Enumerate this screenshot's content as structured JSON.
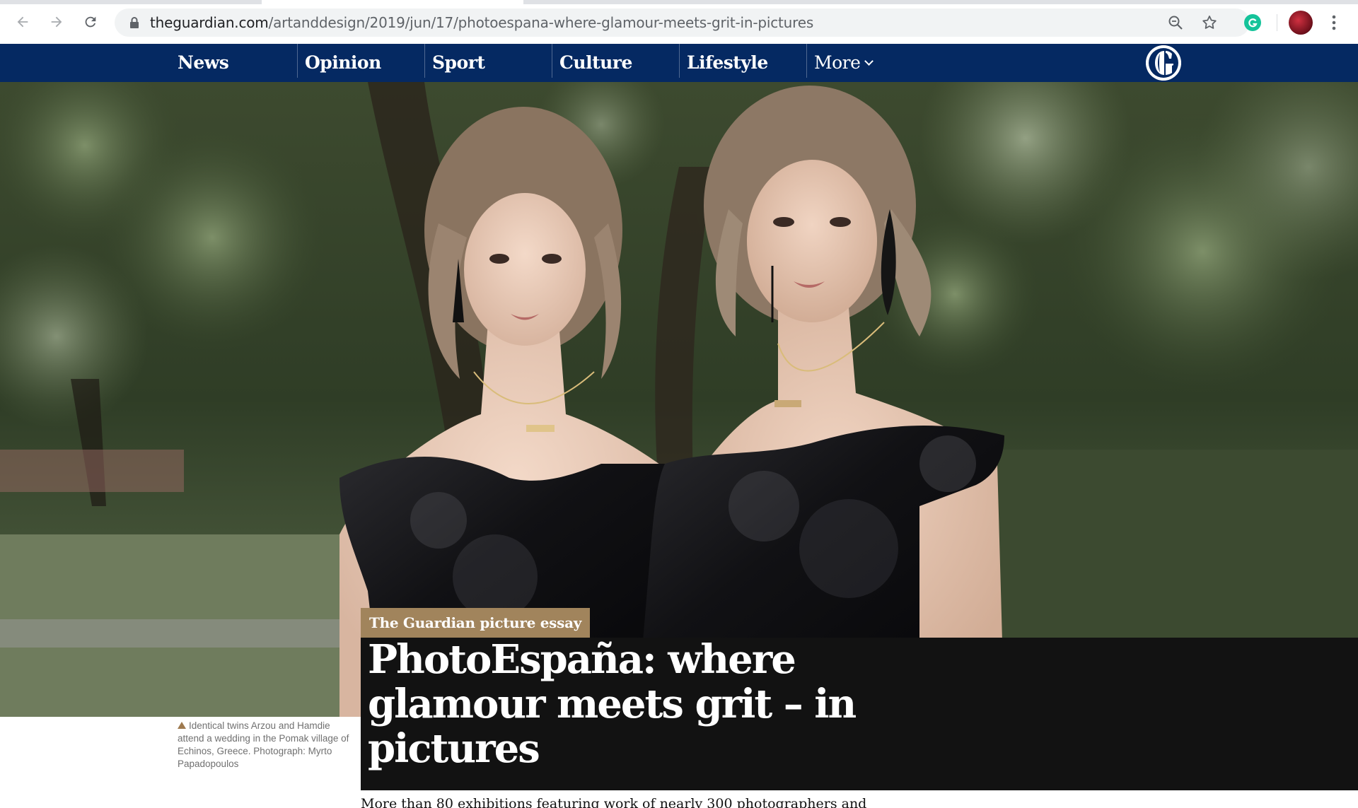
{
  "browser": {
    "url_host": "theguardian.com",
    "url_path": "/artanddesign/2019/jun/17/photoespana-where-glamour-meets-grit-in-pictures",
    "icons": [
      "back-icon",
      "forward-icon",
      "reload-icon",
      "lock-icon",
      "zoom-icon",
      "bookmark-star-icon",
      "grammarly-icon",
      "profile-avatar",
      "menu-icon"
    ]
  },
  "nav": {
    "items": [
      {
        "label": "News"
      },
      {
        "label": "Opinion"
      },
      {
        "label": "Sport"
      },
      {
        "label": "Culture"
      },
      {
        "label": "Lifestyle"
      }
    ],
    "more_label": "More",
    "brand_color": "#052962"
  },
  "article": {
    "kicker": "The Guardian picture essay",
    "kicker_color": "#a1845c",
    "headline": "PhotoEspaña: where glamour meets grit – in pictures",
    "caption": "Identical twins Arzou and Hamdie attend a wedding in the Pomak village of Echinos, Greece. Photograph: Myrto Papadopoulos",
    "standfirst": "More than 80 exhibitions featuring work of nearly 300 photographers and"
  }
}
